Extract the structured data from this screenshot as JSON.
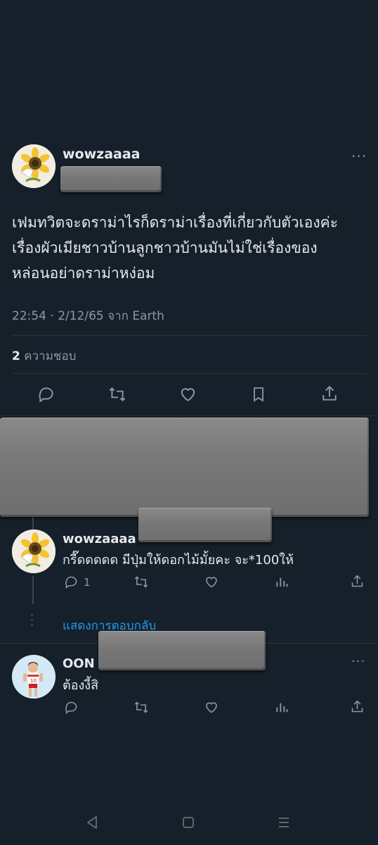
{
  "main_tweet": {
    "username": "wowzaaaa",
    "more_icon": "more-dots-icon",
    "text_lines": [
      "เฟมทวิตจะดราม่าไรก็ดราม่าเรื่องที่เกี่ยวกับตัวเองค่ะ",
      "เรื่องผัวเมียชาวบ้านลูกชาวบ้านมันไม่ใช่เรื่องของ",
      "หล่อนอย่าดราม่าหง่อม"
    ],
    "meta": "22:54 · 2/12/65 จาก Earth",
    "likes_count": "2",
    "likes_label": "ความชอบ",
    "actions": [
      "reply-icon",
      "retweet-icon",
      "like-icon",
      "bookmark-icon",
      "share-icon"
    ]
  },
  "reply_1": {
    "username": "wowzaaaa",
    "text": "กรี๊ดดดดด มีปุ่มให้ดอกไม้มั้ยคะ จะ*100ให้",
    "reply_count": "1",
    "actions": [
      "reply-icon",
      "retweet-icon",
      "like-icon",
      "views-icon",
      "share-icon"
    ]
  },
  "show_replies": "แสดงการตอบกลับ",
  "reply_2": {
    "username": "OON",
    "text": "ต้องงี้สิ",
    "actions": [
      "reply-icon",
      "retweet-icon",
      "like-icon",
      "views-icon",
      "share-icon"
    ]
  },
  "nav_bar": {
    "buttons": [
      "back-icon",
      "home-icon",
      "recents-icon"
    ]
  },
  "colors": {
    "background": "#15202b",
    "text": "#e7e9ea",
    "muted": "#8b98a5",
    "accent": "#1d9bf0"
  }
}
